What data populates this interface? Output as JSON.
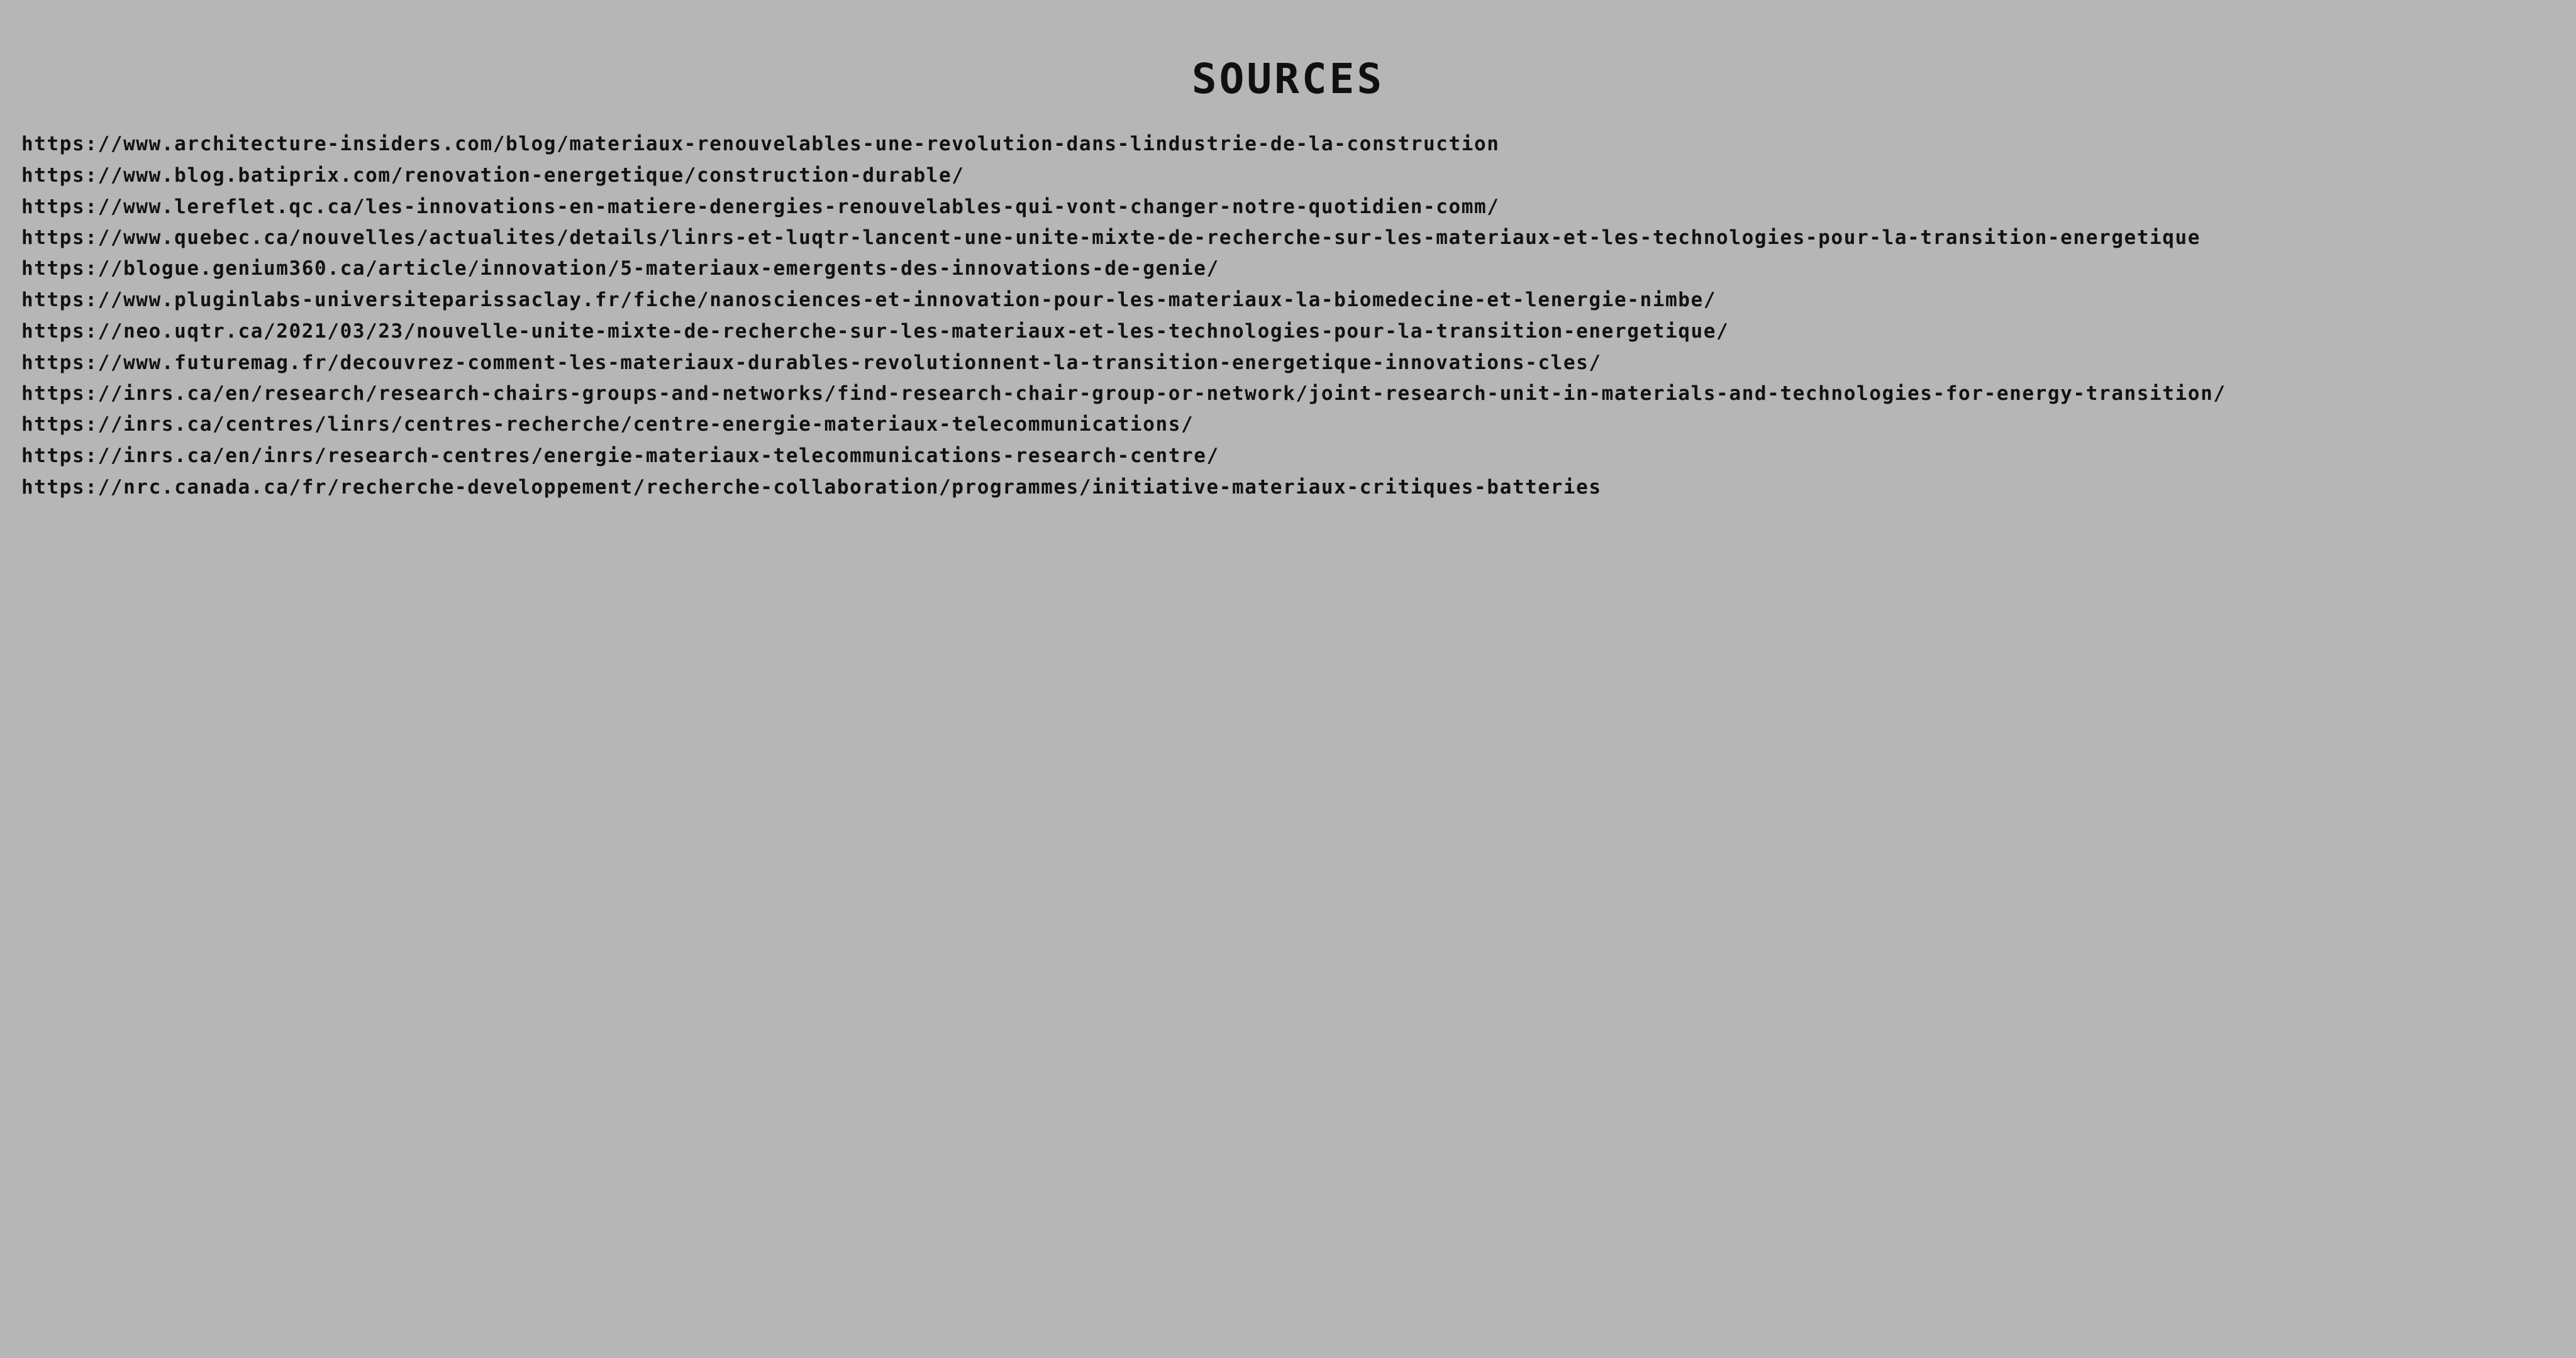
{
  "page": {
    "title": "SOURCES"
  },
  "sources": [
    "https://www.architecture-insiders.com/blog/materiaux-renouvelables-une-revolution-dans-lindustrie-de-la-construction",
    "https://www.blog.batiprix.com/renovation-energetique/construction-durable/",
    "https://www.lereflet.qc.ca/les-innovations-en-matiere-denergies-renouvelables-qui-vont-changer-notre-quotidien-comm/",
    "https://www.quebec.ca/nouvelles/actualites/details/linrs-et-luqtr-lancent-une-unite-mixte-de-recherche-sur-les-materiaux-et-les-technologies-pour-la-transition-energetique",
    "https://blogue.genium360.ca/article/innovation/5-materiaux-emergents-des-innovations-de-genie/",
    "https://www.pluginlabs-universiteparissaclay.fr/fiche/nanosciences-et-innovation-pour-les-materiaux-la-biomedecine-et-lenergie-nimbe/",
    "https://neo.uqtr.ca/2021/03/23/nouvelle-unite-mixte-de-recherche-sur-les-materiaux-et-les-technologies-pour-la-transition-energetique/",
    "https://www.futuremag.fr/decouvrez-comment-les-materiaux-durables-revolutionnent-la-transition-energetique-innovations-cles/",
    "https://inrs.ca/en/research/research-chairs-groups-and-networks/find-research-chair-group-or-network/joint-research-unit-in-materials-and-technologies-for-energy-transition/",
    "https://inrs.ca/centres/linrs/centres-recherche/centre-energie-materiaux-telecommunications/",
    "https://inrs.ca/en/inrs/research-centres/energie-materiaux-telecommunications-research-centre/",
    "https://nrc.canada.ca/fr/recherche-developpement/recherche-collaboration/programmes/initiative-materiaux-critiques-batteries"
  ]
}
